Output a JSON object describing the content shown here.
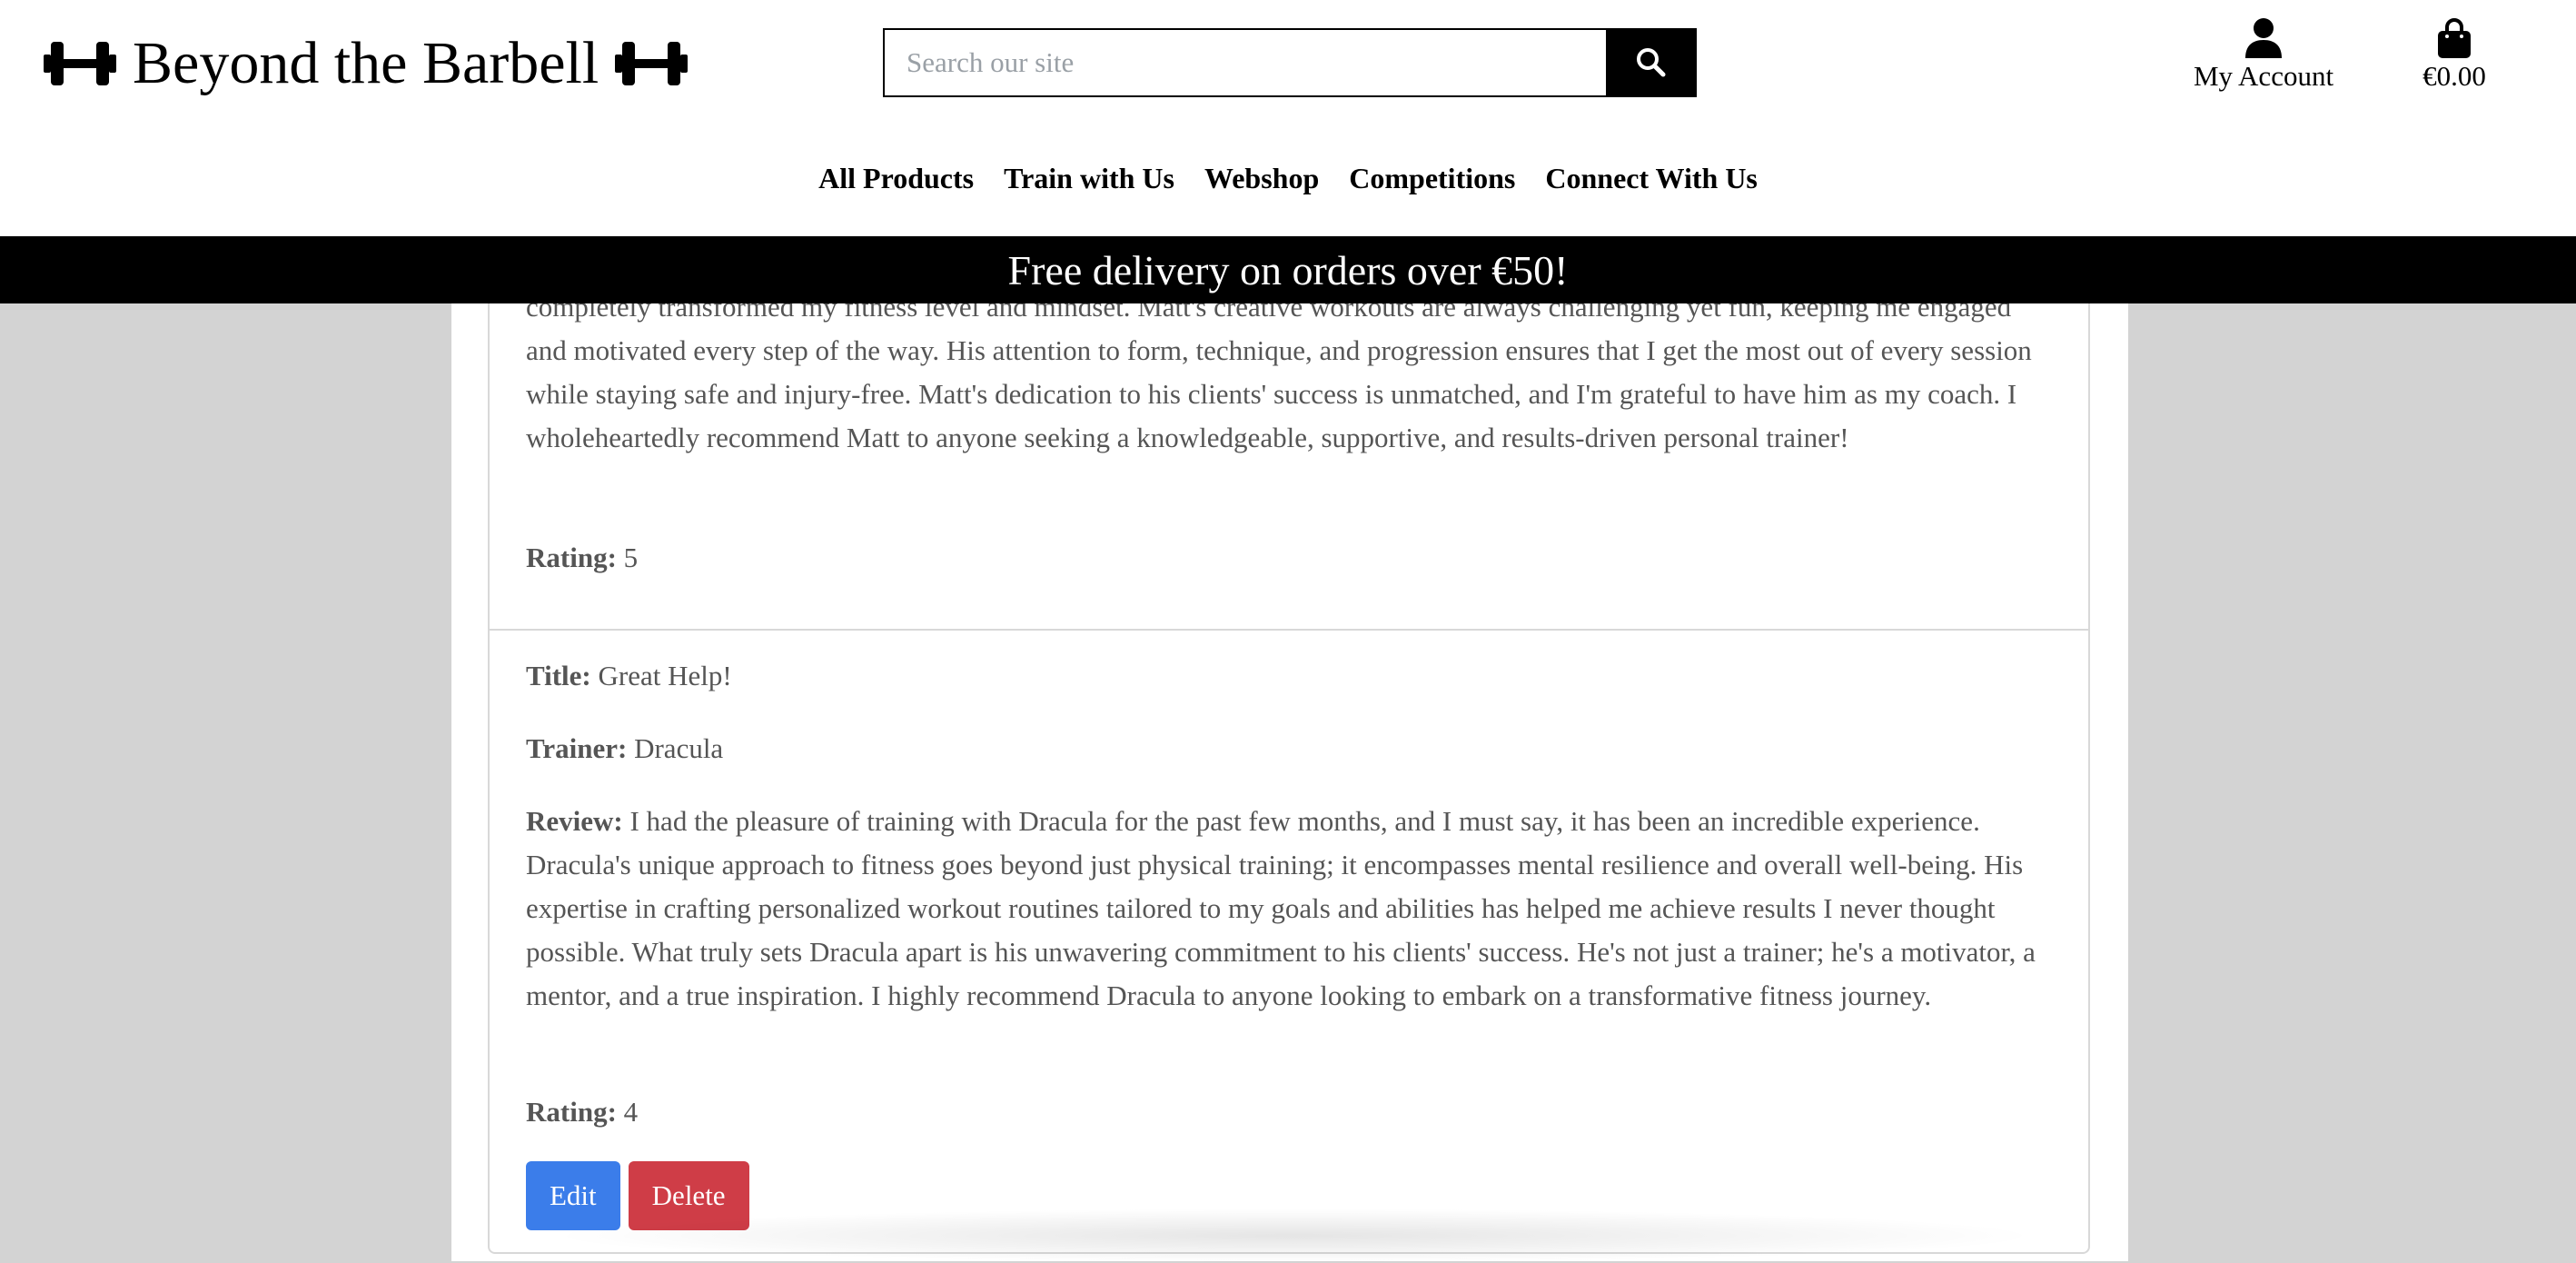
{
  "brand": {
    "name": "Beyond the Barbell",
    "icon": "dumbbell-icon"
  },
  "search": {
    "placeholder": "Search our site",
    "icon": "search-icon"
  },
  "account": {
    "label": "My Account",
    "icon": "user-icon"
  },
  "cart": {
    "total": "€0.00",
    "icon": "shopping-bag-icon"
  },
  "nav": {
    "items": [
      "All Products",
      "Train with Us",
      "Webshop",
      "Competitions",
      "Connect With Us"
    ]
  },
  "banner": {
    "text": "Free delivery on orders over €50!"
  },
  "labels": {
    "title": "Title:",
    "trainer": "Trainer:",
    "review": "Review:",
    "rating": "Rating:"
  },
  "reviews": [
    {
      "review_visible": "completely transformed my fitness level and mindset. Matt's creative workouts are always challenging yet fun, keeping me engaged and motivated every step of the way. His attention to form, technique, and progression ensures that I get the most out of every session while staying safe and injury-free. Matt's dedication to his clients' success is unmatched, and I'm grateful to have him as my coach. I wholeheartedly recommend Matt to anyone seeking a knowledgeable, supportive, and results-driven personal trainer!",
      "rating": "5"
    },
    {
      "title": "Great Help!",
      "trainer": "Dracula",
      "review": "I had the pleasure of training with Dracula for the past few months, and I must say, it has been an incredible experience. Dracula's unique approach to fitness goes beyond just physical training; it encompasses mental resilience and overall well-being. His expertise in crafting personalized workout routines tailored to my goals and abilities has helped me achieve results I never thought possible. What truly sets Dracula apart is his unwavering commitment to his clients' success. He's not just a trainer; he's a motivator, a mentor, and a true inspiration. I highly recommend Dracula to anyone looking to embark on a transformative fitness journey.",
      "rating": "4"
    }
  ],
  "actions": {
    "edit": "Edit",
    "delete": "Delete"
  },
  "colors": {
    "edit": "#3b7dea",
    "delete": "#cf3d47",
    "banner": "#000000",
    "page_bg": "#d3d3d3"
  }
}
